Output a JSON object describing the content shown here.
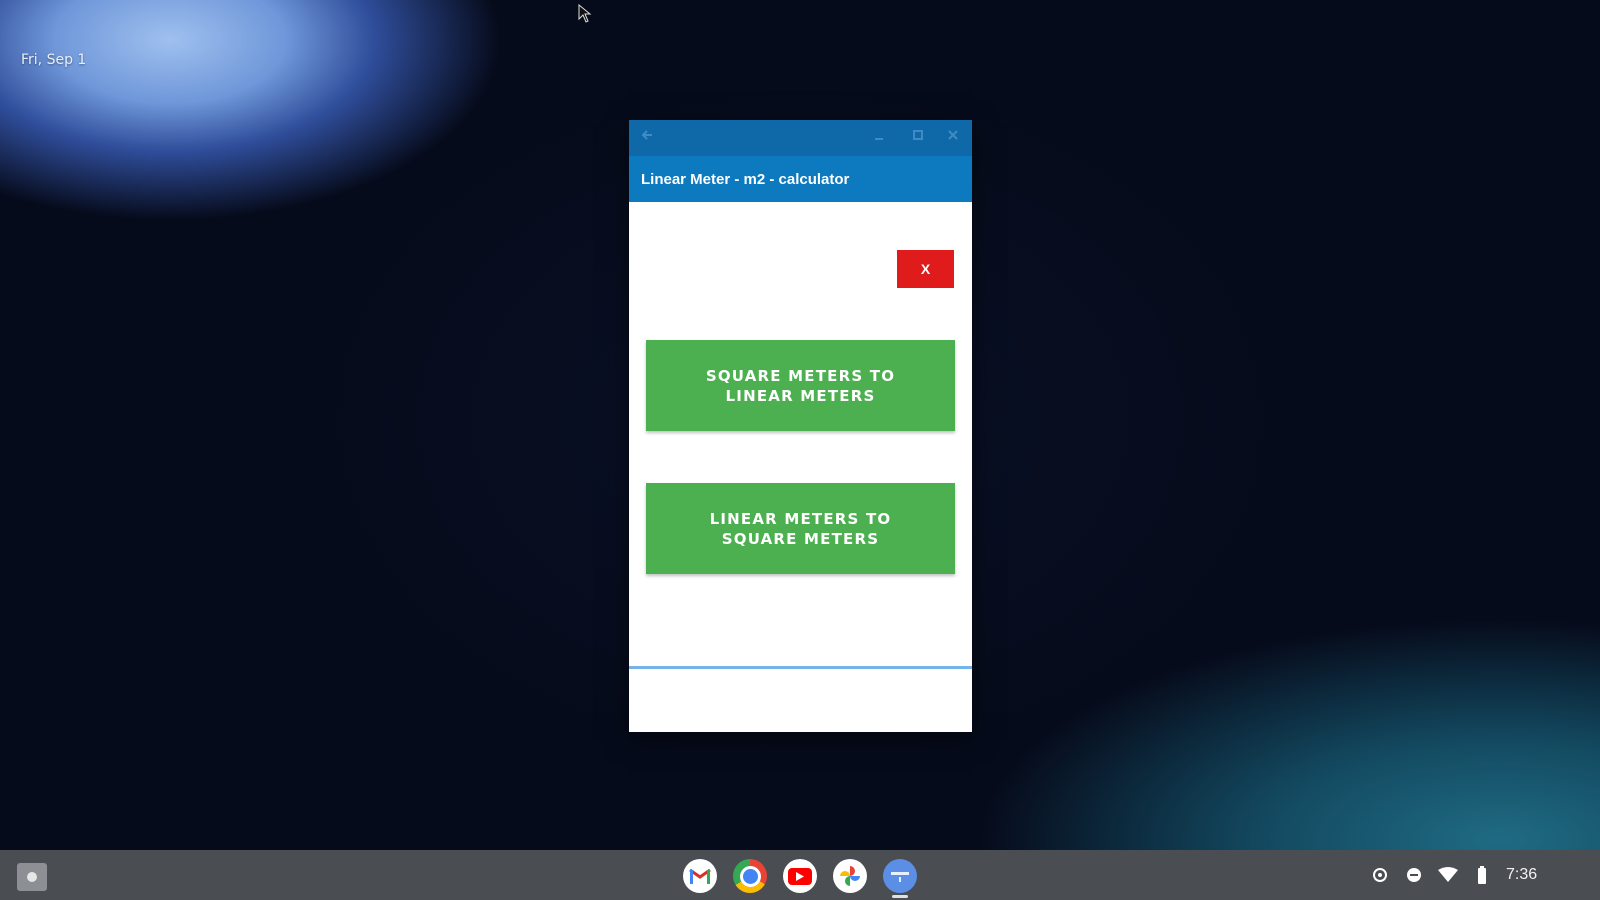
{
  "desktop": {
    "date": "Fri, Sep 1"
  },
  "window": {
    "caption": {
      "back_icon": "arrow-left-icon",
      "minimize_icon": "minimize-icon",
      "maximize_icon": "maximize-icon",
      "close_icon": "close-icon"
    },
    "title": "Linear Meter - m2 - calculator"
  },
  "content": {
    "close_button_label": "X",
    "square_to_linear_label": "SQUARE METERS TO LINEAR METERS",
    "linear_to_square_label": "LINEAR METERS TO SQUARE METERS",
    "colors": {
      "caption": "#0f69a9",
      "appbar": "#0d79bf",
      "button_green": "#4caf50",
      "button_red": "#e01b1b"
    }
  },
  "shelf": {
    "apps": [
      "gmail-icon",
      "chrome-icon",
      "youtube-icon",
      "photos-icon",
      "calculator-app-icon"
    ],
    "status": {
      "settings_icon": "gear-icon",
      "dnd_icon": "do-not-disturb-icon",
      "wifi_icon": "wifi-icon",
      "battery_icon": "battery-icon",
      "time": "7:36"
    }
  }
}
